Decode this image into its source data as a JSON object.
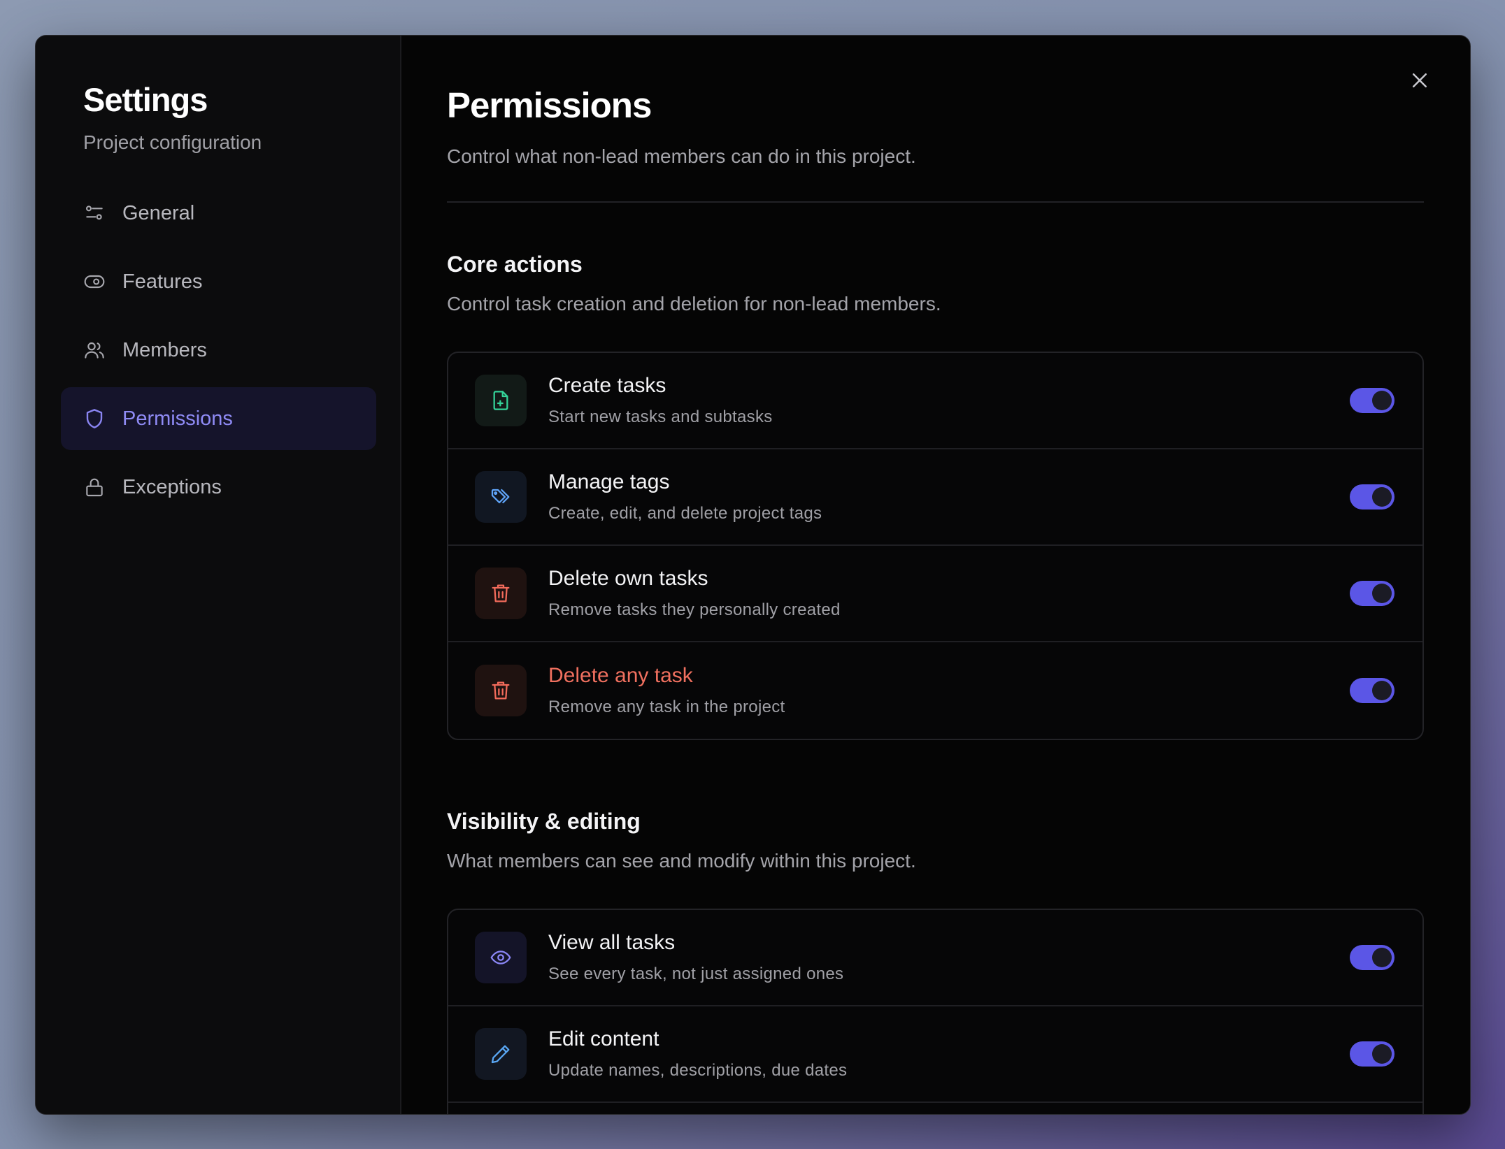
{
  "sidebar": {
    "title": "Settings",
    "subtitle": "Project configuration",
    "items": [
      {
        "label": "General",
        "icon": "sliders-icon"
      },
      {
        "label": "Features",
        "icon": "toggle-icon"
      },
      {
        "label": "Members",
        "icon": "users-icon"
      },
      {
        "label": "Permissions",
        "icon": "shield-icon",
        "active": true
      },
      {
        "label": "Exceptions",
        "icon": "lock-icon"
      }
    ]
  },
  "main": {
    "title": "Permissions",
    "description": "Control what non-lead members can do in this project.",
    "sections": [
      {
        "title": "Core actions",
        "description": "Control task creation and deletion for non-lead members.",
        "rows": [
          {
            "title": "Create tasks",
            "subtitle": "Start new tasks and subtasks",
            "icon": "file-plus-icon",
            "enabled": true
          },
          {
            "title": "Manage tags",
            "subtitle": "Create, edit, and delete project tags",
            "icon": "tags-icon",
            "enabled": true
          },
          {
            "title": "Delete own tasks",
            "subtitle": "Remove tasks they personally created",
            "icon": "trash-icon",
            "enabled": true
          },
          {
            "title": "Delete any task",
            "subtitle": "Remove any task in the project",
            "icon": "trash-icon",
            "enabled": true,
            "danger": true
          }
        ]
      },
      {
        "title": "Visibility & editing",
        "description": "What members can see and modify within this project.",
        "rows": [
          {
            "title": "View all tasks",
            "subtitle": "See every task, not just assigned ones",
            "icon": "eye-icon",
            "enabled": true
          },
          {
            "title": "Edit content",
            "subtitle": "Update names, descriptions, due dates",
            "icon": "pencil-icon",
            "enabled": true
          }
        ]
      }
    ]
  },
  "colors": {
    "accent": "#5b56e6",
    "active_nav_text": "#8f8bf5",
    "danger": "#f0705f",
    "background": "#050505"
  }
}
